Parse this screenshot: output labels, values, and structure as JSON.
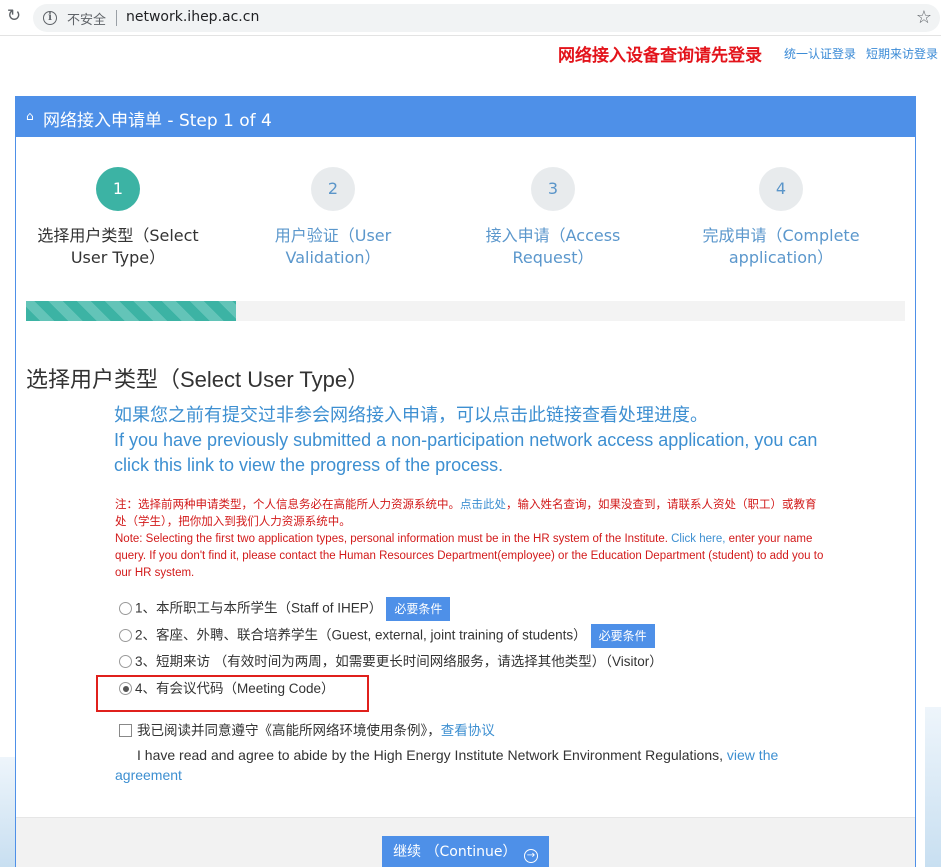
{
  "browser": {
    "reload_glyph": "↻",
    "security_label": "不安全",
    "url": "network.ihep.ac.cn",
    "star_glyph": "☆"
  },
  "header": {
    "login_alert": "网络接入设备查询请先登录",
    "unified_login": "统一认证登录",
    "visitor_login": "短期来访登录"
  },
  "panel": {
    "title": "网络接入申请单 - Step 1 of 4",
    "progress_fraction": 0.25
  },
  "steps": [
    {
      "number": "1",
      "label": "选择用户类型（Select User Type）",
      "active": true
    },
    {
      "number": "2",
      "label": "用户验证（User Validation）",
      "active": false
    },
    {
      "number": "3",
      "label": "接入申请（Access Request）",
      "active": false
    },
    {
      "number": "4",
      "label": "完成申请（Complete application）",
      "active": false
    }
  ],
  "section": {
    "heading": "选择用户类型（Select User Type）",
    "prev_link_cn": "如果您之前有提交过非参会网络接入申请，可以点击此链接查看处理进度。",
    "prev_link_en": "If you have previously submitted a non-participation network access application, you can click this link to view the progress of the process."
  },
  "note": {
    "cn_part1": "注：选择前两种申请类型，个人信息务必在高能所人力资源系统中。",
    "cn_link": "点击此处",
    "cn_part2": "，输入姓名查询，如果没查到，请联系人资处（职工）或教育处（学生），把你加入到我们人力资源系统中。",
    "en_part1": "Note: Selecting the first two application types, personal information must be in the HR system of the Institute. ",
    "en_link": "Click here,",
    "en_part2": " enter your name query. If you don't find it, please contact the Human Resources Department(employee) or the Education Department (student) to add you to our HR system."
  },
  "options": [
    {
      "label": "1、本所职工与本所学生（Staff of IHEP）",
      "button": "必要条件",
      "checked": false
    },
    {
      "label": "2、客座、外聘、联合培养学生（Guest, external, joint training of students）",
      "button": "必要条件",
      "checked": false
    },
    {
      "label": "3、短期来访 （有效时间为两周，如需要更长时间网络服务，请选择其他类型）（Visitor）",
      "button": "",
      "checked": false
    },
    {
      "label": "4、有会议代码（Meeting Code）",
      "button": "",
      "checked": true
    }
  ],
  "agreement": {
    "cn_text": "我已阅读并同意遵守《高能所网络环境使用条例》，",
    "cn_link": "查看协议",
    "en_text": "I have read and agree to abide by the High Energy Institute Network Environment Regulations, ",
    "en_link": "view the agreement"
  },
  "footer": {
    "continue_label": "继续 （Continue）",
    "continue_icon_glyph": "→"
  },
  "colors": {
    "accent_blue": "#4e90e8",
    "step_active": "#3cb3a4",
    "alert_red": "#e3141b",
    "link_blue": "#3d8fd1"
  },
  "icons": [
    "reload-icon",
    "info-icon",
    "star-icon",
    "home-icon",
    "arrow-circle-icon"
  ]
}
